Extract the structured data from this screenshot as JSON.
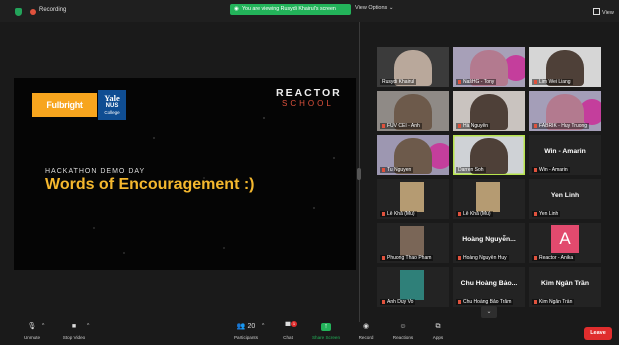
{
  "top": {
    "recording_label": "Recording",
    "banner_text": "You are viewing Rusydi Khairul's screen",
    "view_options_label": "View Options ⌄",
    "view_label": "View"
  },
  "slide": {
    "fulbright_label": "Fulbright",
    "yale_name": "Yale",
    "yale_nus": "NUS",
    "yale_college": "College",
    "reactor": "REACTOR",
    "school": "SCHOOL",
    "event": "HACKATHON DEMO DAY",
    "headline": "Words of Encouragement :)"
  },
  "participants": [
    {
      "name": "Rusydi Khairul",
      "muted": false,
      "kind": "video"
    },
    {
      "name": "NašHG - Tony",
      "muted": true,
      "kind": "video"
    },
    {
      "name": "Lim Wei Liang",
      "muted": true,
      "kind": "video"
    },
    {
      "name": "FUV CEI - Anh",
      "muted": true,
      "kind": "video"
    },
    {
      "name": "Hà Nguyễn",
      "muted": true,
      "kind": "video"
    },
    {
      "name": "FABRIK - Huy Truong",
      "muted": true,
      "kind": "video"
    },
    {
      "name": "Tu Nguyen",
      "muted": true,
      "kind": "video"
    },
    {
      "name": "Darren Soh",
      "muted": false,
      "kind": "video",
      "active": true
    },
    {
      "name": "Win - Amarin",
      "muted": true,
      "kind": "name",
      "display": "Win - Amarin"
    },
    {
      "name": "Lê Khả (Mu)",
      "muted": true,
      "kind": "photo"
    },
    {
      "name": "Lê Khả (Mu)",
      "muted": true,
      "kind": "photo"
    },
    {
      "name": "Yen Linh",
      "muted": true,
      "kind": "name",
      "display": "Yen Linh"
    },
    {
      "name": "Phuong Thao Pham",
      "muted": true,
      "kind": "photo"
    },
    {
      "name": "Hoàng Nguyễn Huy",
      "muted": true,
      "kind": "name",
      "display": "Hoàng Nguyễn..."
    },
    {
      "name": "Reactor - Anika",
      "muted": true,
      "kind": "avatar",
      "display": "A"
    },
    {
      "name": "Anh Duy Vo",
      "muted": true,
      "kind": "photo"
    },
    {
      "name": "Chu Hoàng Bảo Trâm",
      "muted": true,
      "kind": "name",
      "display": "Chu Hoàng Bảo..."
    },
    {
      "name": "Kim Ngân Trần",
      "muted": true,
      "kind": "name",
      "display": "Kim Ngân Trần"
    }
  ],
  "more_label": "⌄",
  "toolbar": {
    "unmute": "Unmute",
    "stop_video": "Stop Video",
    "participants": "Participants",
    "participants_count": "20",
    "chat": "Chat",
    "chat_badge": "1",
    "share_screen": "Share Screen",
    "record": "Record",
    "reactions": "Reactions",
    "apps": "Apps",
    "leave": "Leave"
  },
  "colors": {
    "accent_green": "#23b35a",
    "leave_red": "#e02d2d",
    "headline_yellow": "#f5b82e",
    "school_red": "#e0523d"
  }
}
